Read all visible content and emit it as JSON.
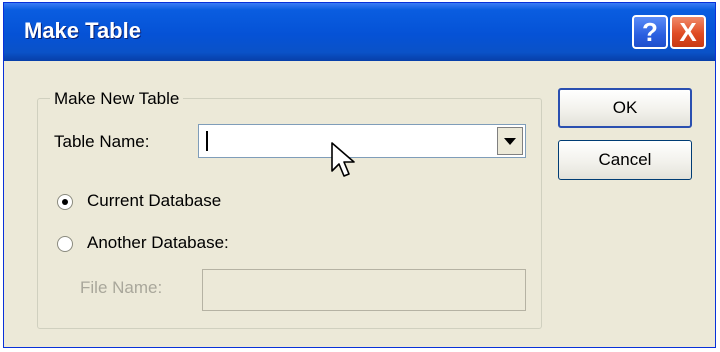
{
  "dialog": {
    "title": "Make Table",
    "help_icon": "?",
    "close_icon": "X"
  },
  "group": {
    "label": "Make New Table",
    "table_name_label": "Table Name:",
    "table_name_value": "",
    "current_db_label": "Current Database",
    "another_db_label": "Another Database:",
    "file_name_label": "File Name:",
    "file_name_value": "",
    "selected_option": "Current Database"
  },
  "buttons": {
    "ok": "OK",
    "cancel": "Cancel"
  },
  "icons": {
    "help": "question-mark-icon",
    "close": "close-icon",
    "dropdown": "chevron-down-icon",
    "cursor": "mouse-pointer-icon"
  }
}
